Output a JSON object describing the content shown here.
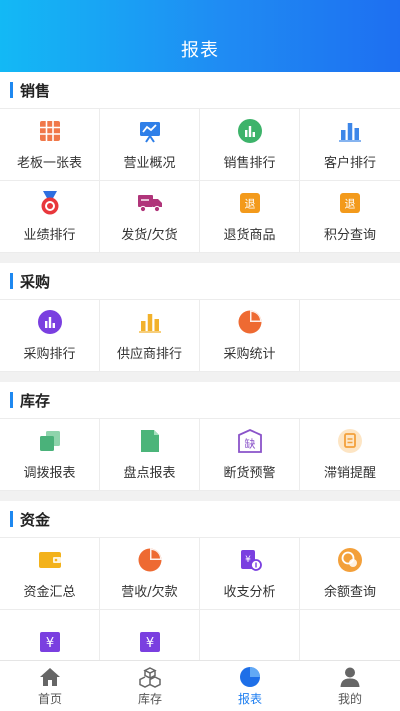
{
  "header": {
    "title": "报表"
  },
  "sections": [
    {
      "title": "销售",
      "items": [
        {
          "label": "老板一张表",
          "icon": "table-grid-icon",
          "color": "#f0784a"
        },
        {
          "label": "营业概况",
          "icon": "presentation-board-icon",
          "color": "#2f7fe8"
        },
        {
          "label": "销售排行",
          "icon": "bar-chart-circle-icon",
          "color": "#3db36a"
        },
        {
          "label": "客户排行",
          "icon": "bar-chart-icon",
          "color": "#3d86e8"
        },
        {
          "label": "业绩排行",
          "icon": "medal-icon",
          "color": "#e8373c"
        },
        {
          "label": "发货/欠货",
          "icon": "delivery-truck-icon",
          "color": "#b0357a"
        },
        {
          "label": "退货商品",
          "icon": "return-goods-icon",
          "color": "#f39a1b"
        },
        {
          "label": "积分查询",
          "icon": "points-query-icon",
          "color": "#f39a1b"
        }
      ]
    },
    {
      "title": "采购",
      "items": [
        {
          "label": "采购排行",
          "icon": "bar-chart-circle-icon",
          "color": "#7a3fe0"
        },
        {
          "label": "供应商排行",
          "icon": "bar-chart-icon",
          "color": "#f2b12b"
        },
        {
          "label": "采购统计",
          "icon": "pie-chart-icon",
          "color": "#ee6a32"
        }
      ]
    },
    {
      "title": "库存",
      "items": [
        {
          "label": "调拨报表",
          "icon": "transfer-docs-icon",
          "color": "#4ab27a"
        },
        {
          "label": "盘点报表",
          "icon": "inventory-doc-icon",
          "color": "#4cb57a"
        },
        {
          "label": "断货预警",
          "icon": "stockout-warning-icon",
          "color": "#8a53c9"
        },
        {
          "label": "滞销提醒",
          "icon": "slow-sales-icon",
          "color": "#f3a03a"
        }
      ]
    },
    {
      "title": "资金",
      "items": [
        {
          "label": "资金汇总",
          "icon": "wallet-icon",
          "color": "#f3b21b"
        },
        {
          "label": "营收/欠款",
          "icon": "pie-chart-icon",
          "color": "#ee6a32"
        },
        {
          "label": "收支分析",
          "icon": "income-analysis-icon",
          "color": "#7a3fe0"
        },
        {
          "label": "余额查询",
          "icon": "balance-coin-icon",
          "color": "#f3a03a"
        },
        {
          "label": "",
          "icon": "currency-icon",
          "color": "#7a3fe0"
        },
        {
          "label": "",
          "icon": "currency-icon",
          "color": "#7a3fe0"
        }
      ]
    }
  ],
  "tabbar": {
    "items": [
      {
        "label": "首页",
        "icon": "home-icon",
        "active": false
      },
      {
        "label": "库存",
        "icon": "stock-boxes-icon",
        "active": false
      },
      {
        "label": "报表",
        "icon": "report-pie-icon",
        "active": true
      },
      {
        "label": "我的",
        "icon": "profile-icon",
        "active": false
      }
    ]
  }
}
